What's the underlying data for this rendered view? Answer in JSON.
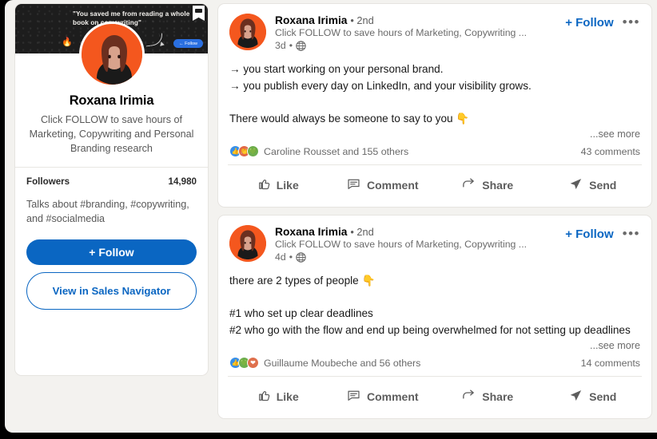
{
  "profile": {
    "banner": {
      "quote": "\"You saved me from reading a whole book on copywriting\"",
      "follow_label": "← Follow",
      "badge_icon": "bookmark-badge-icon",
      "arrow_icon": "curved-arrow-icon",
      "emoji": "🔥",
      "bg_color": "#1d1d1d"
    },
    "avatar_icon": "profile-avatar",
    "name": "Roxana Irimia",
    "headline": "Click FOLLOW to save hours of Marketing, Copywriting and Personal Branding research",
    "followers_label": "Followers",
    "followers_value": "14,980",
    "talks_about": "Talks about #branding, #copywriting, and #socialmedia",
    "follow_button": "+ Follow",
    "sales_navigator_button": "View in Sales Navigator",
    "accent_color": "#0a66c2"
  },
  "feed": {
    "posts": [
      {
        "author": "Roxana Irimia",
        "degree": "• 2nd",
        "headline": "Click FOLLOW to save hours of Marketing, Copywriting ...",
        "time": "3d",
        "visibility_icon": "globe-icon",
        "follow_label": "+ Follow",
        "more_label": "•••",
        "body": "→ you start working on your personal brand.\n→ you publish every day on LinkedIn, and your visibility grows.\n\nThere would always be someone to say to you 👇",
        "see_more": "...see more",
        "reactions": [
          "like",
          "celebrate",
          "support"
        ],
        "reaction_text": "Caroline Rousset and 155 others",
        "comments": "43 comments",
        "actions": [
          {
            "label": "Like",
            "icon": "thumbs-up-icon"
          },
          {
            "label": "Comment",
            "icon": "comment-bubble-icon"
          },
          {
            "label": "Share",
            "icon": "share-arrow-icon"
          },
          {
            "label": "Send",
            "icon": "send-paper-plane-icon"
          }
        ]
      },
      {
        "author": "Roxana Irimia",
        "degree": "• 2nd",
        "headline": "Click FOLLOW to save hours of Marketing, Copywriting ...",
        "time": "4d",
        "visibility_icon": "globe-icon",
        "follow_label": "+ Follow",
        "more_label": "•••",
        "body": "there are 2 types of people 👇\n\n#1 who set up clear deadlines\n#2 who go with the flow and end up being overwhelmed for not setting up deadlines",
        "see_more": "...see more",
        "reactions": [
          "like",
          "support",
          "love"
        ],
        "reaction_text": "Guillaume Moubeche and 56 others",
        "comments": "14 comments",
        "actions": [
          {
            "label": "Like",
            "icon": "thumbs-up-icon"
          },
          {
            "label": "Comment",
            "icon": "comment-bubble-icon"
          },
          {
            "label": "Share",
            "icon": "share-arrow-icon"
          },
          {
            "label": "Send",
            "icon": "send-paper-plane-icon"
          }
        ]
      }
    ]
  }
}
